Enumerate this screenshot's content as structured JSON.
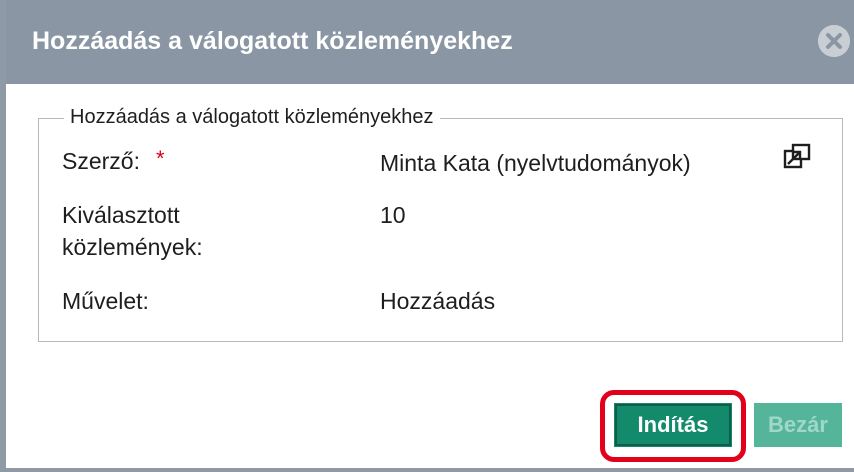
{
  "dialog": {
    "title": "Hozzáadás a válogatott közleményekhez",
    "close_icon": "close-circle-icon"
  },
  "form": {
    "legend": "Hozzáadás a válogatott közleményekhez",
    "author_label": "Szerző:",
    "author_required": "*",
    "author_value": "Minta Kata (nyelvtudományok)",
    "author_popout_icon": "open-external-icon",
    "selected_label_line1": "Kiválasztott",
    "selected_label_line2": "közlemények:",
    "selected_value": "10",
    "operation_label": "Művelet:",
    "operation_value": "Hozzáadás"
  },
  "buttons": {
    "start_label": "Indítás",
    "close_label": "Bezár"
  },
  "colors": {
    "titlebar": "#8a96a3",
    "primary_button": "#138a6c",
    "disabled_button": "#55b59b",
    "highlight": "#e2001a",
    "required": "#d9001b"
  }
}
